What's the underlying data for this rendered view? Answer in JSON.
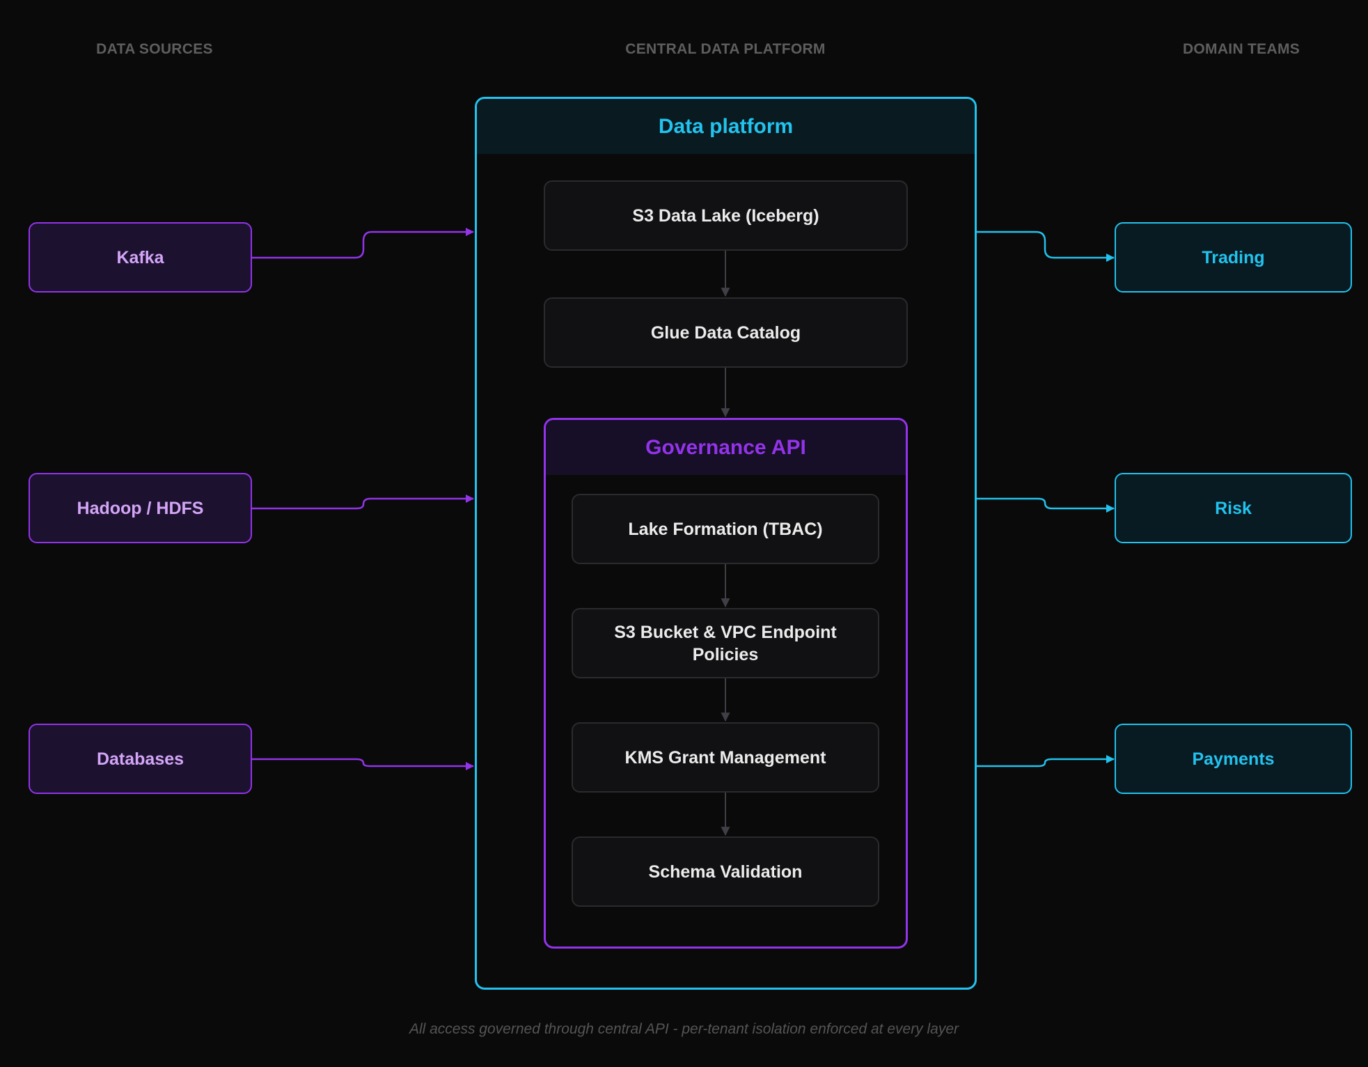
{
  "columns": {
    "sources": "DATA SOURCES",
    "platform": "CENTRAL DATA PLATFORM",
    "domains": "DOMAIN TEAMS"
  },
  "sources": [
    "Kafka",
    "Hadoop / HDFS",
    "Databases"
  ],
  "platform": {
    "title": "Data platform",
    "lake": "S3 Data Lake (Iceberg)",
    "catalog": "Glue Data Catalog",
    "governance": {
      "title": "Governance API",
      "steps": [
        "Lake Formation (TBAC)",
        "S3 Bucket & VPC Endpoint Policies",
        "KMS Grant Management",
        "Schema Validation"
      ]
    }
  },
  "domains": [
    "Trading",
    "Risk",
    "Payments"
  ],
  "caption": "All access governed through central API - per-tenant isolation enforced at every layer",
  "colors": {
    "source_accent": "#9333ea",
    "domain_accent": "#22c3ee",
    "inner_arrow": "#3f3f46"
  }
}
